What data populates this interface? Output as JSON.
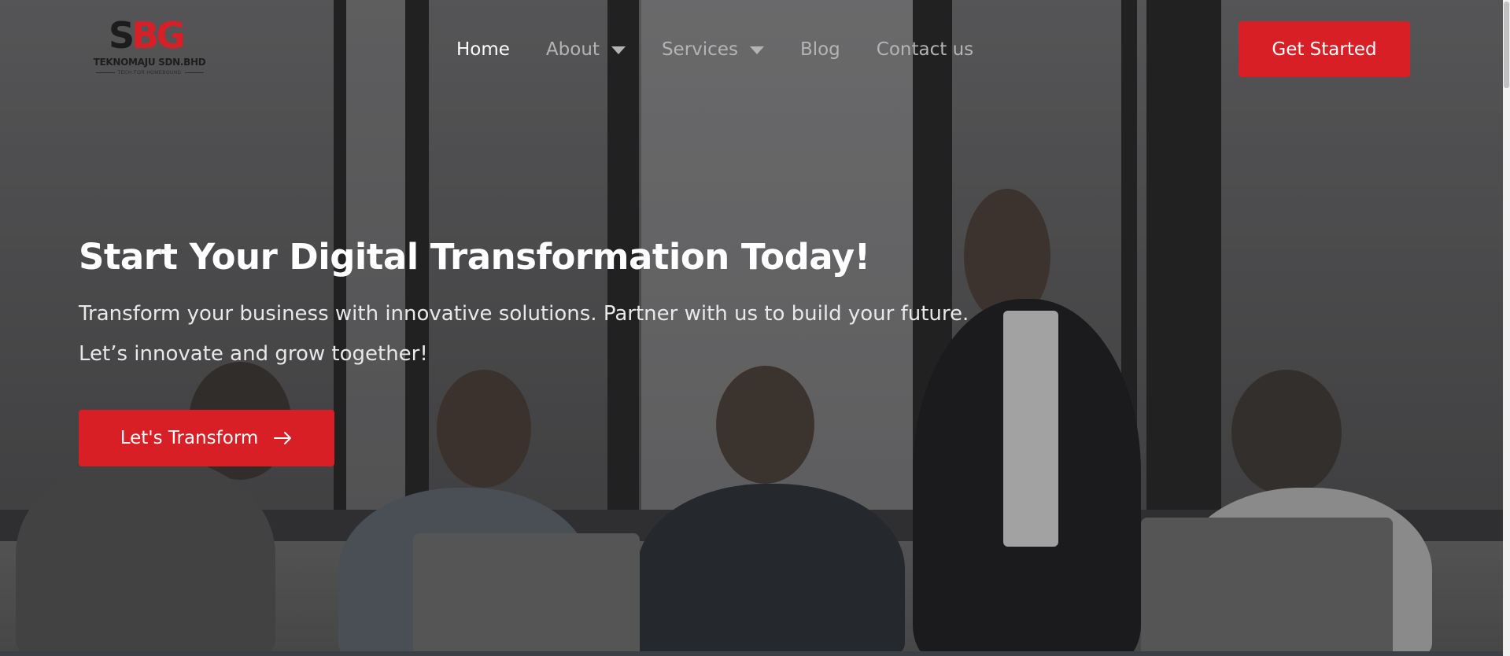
{
  "brand": {
    "logo_letters": [
      "S",
      "B",
      "G"
    ],
    "company_name": "TEKNOMAJU SDN.BHD",
    "tagline": "TECH FOR HOMEBOUND",
    "accent_color": "#d91f26"
  },
  "nav": {
    "items": [
      {
        "label": "Home",
        "active": true,
        "has_dropdown": false
      },
      {
        "label": "About",
        "active": false,
        "has_dropdown": true
      },
      {
        "label": "Services",
        "active": false,
        "has_dropdown": true
      },
      {
        "label": "Blog",
        "active": false,
        "has_dropdown": false
      },
      {
        "label": "Contact us",
        "active": false,
        "has_dropdown": false
      }
    ],
    "dropdown_icon": "caret-down-icon"
  },
  "header": {
    "cta_label": "Get Started"
  },
  "hero": {
    "title": "Start Your Digital Transformation Today!",
    "subtitle": "Transform your business with innovative solutions. Partner with us to build your future. Let’s innovate and grow together!",
    "button_label": "Let's Transform",
    "button_icon": "arrow-right-icon",
    "background_image": "office-team-photo"
  }
}
